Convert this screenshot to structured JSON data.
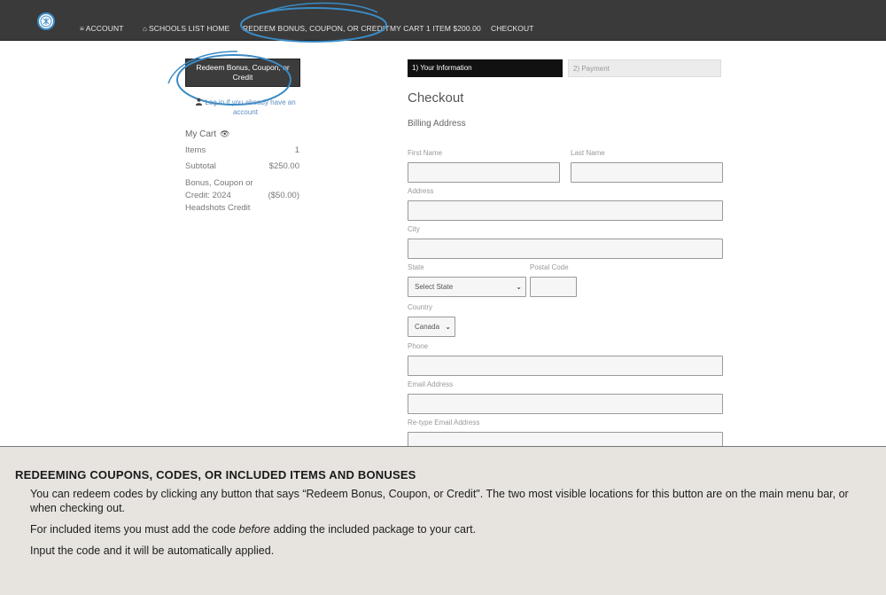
{
  "nav": {
    "account": "ACCOUNT",
    "schools_home": "SCHOOLS LIST HOME",
    "redeem": "REDEEM BONUS, COUPON, OR CREDIT",
    "cart": "MY CART 1 ITEM $200.00",
    "checkout": "CHECKOUT"
  },
  "sidebar": {
    "redeem_button": "Redeem Bonus, Coupon, or Credit",
    "login_link": "Log in if you already have an account",
    "cart_title": "My Cart",
    "items_label": "Items",
    "items_value": "1",
    "subtotal_label": "Subtotal",
    "subtotal_value": "$250.00",
    "bonus_label": "Bonus, Coupon or Credit: 2024 Headshots Credit",
    "bonus_value": "($50.00)"
  },
  "steps": {
    "step1": "1) Your Information",
    "step2": "2) Payment"
  },
  "form": {
    "title": "Checkout",
    "section": "Billing Address",
    "first_name": "First Name",
    "last_name": "Last Name",
    "address": "Address",
    "city": "City",
    "state": "State",
    "state_value": "Select State",
    "postal": "Postal Code",
    "country": "Country",
    "country_value": "Canada",
    "phone": "Phone",
    "email": "Email Address",
    "email_retype": "Re-type Email Address"
  },
  "info": {
    "title": "REDEEMING COUPONS, CODES, OR INCLUDED ITEMS AND BONUSES",
    "p1": "You can redeem codes by clicking any button that says “Redeem Bonus, Coupon, or Credit\". The two most visible locations for this button are on the main menu bar, or when checking out.",
    "p2_before": "For included items you must add the code ",
    "p2_em": "before",
    "p2_after": " adding the included package to your cart.",
    "p3": "Input the code and it will be automatically applied."
  },
  "colors": {
    "navbar": "#3a3a3a",
    "annotation": "#3a8bc6",
    "link": "#5b8ec4",
    "info_bg": "#e7e4e0"
  }
}
